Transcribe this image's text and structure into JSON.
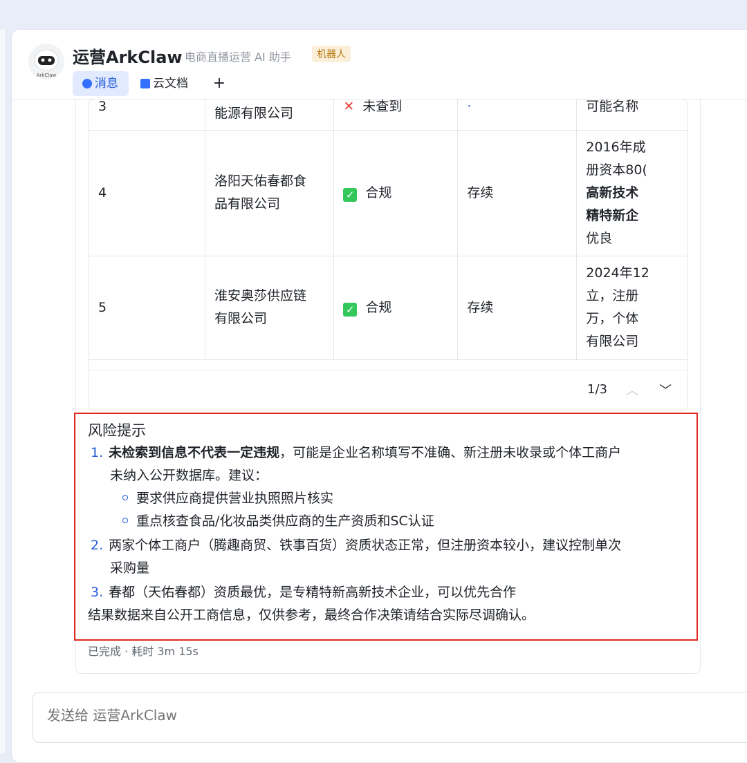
{
  "header": {
    "bot_name": "运营ArkClaw",
    "bot_subtitle": "电商直播运营 AI 助手",
    "bot_tag": "机器人",
    "avatar_label": "ArkClaw",
    "tabs": [
      {
        "label": "消息",
        "icon": "message-icon"
      },
      {
        "label": "云文档",
        "icon": "doc-icon"
      },
      {
        "label": "+",
        "icon": "plus-icon"
      }
    ]
  },
  "table": {
    "rows": [
      {
        "no": "3",
        "company_lines": [
          "",
          "能源有限公司"
        ],
        "compliance": "未查到",
        "compliance_icon": "cross-icon",
        "status": "·",
        "note_lines": [
          "可能名称"
        ]
      },
      {
        "no": "4",
        "company_lines": [
          "洛阳天佑春都食",
          "品有限公司"
        ],
        "compliance": "合规",
        "compliance_icon": "check-icon",
        "status": "存续",
        "note_lines": [
          "2016年成",
          "册资本80(",
          "高新技术",
          "精特新企",
          "优良"
        ]
      },
      {
        "no": "5",
        "company_lines": [
          "淮安奥莎供应链",
          "有限公司"
        ],
        "compliance": "合规",
        "compliance_icon": "check-icon",
        "status": "存续",
        "note_lines": [
          "2024年12",
          "立，注册",
          "万，个体",
          "有限公司"
        ]
      }
    ],
    "pager": "1/3"
  },
  "risk": {
    "title": "风险提示",
    "item1_bold": "未检索到信息不代表一定违规",
    "item1_rest": "，可能是企业名称填写不准确、新注册未收录或个体工商户",
    "item1_cont": "未纳入公开数据库。建议：",
    "sub1": "要求供应商提供营业执照照片核实",
    "sub2": "重点核查食品/化妆品类供应商的生产资质和SC认证",
    "item2": "两家个体工商户（腾趣商贸、铁事百货）资质状态正常，但注册资本较小，建议控制单次",
    "item2_cont": "采购量",
    "item3": "春都（天佑春都）资质最优，是专精特新高新技术企业，可以优先合作",
    "footer": "结果数据来自公开工商信息，仅供参考，最终合作决策请结合实际尽调确认。"
  },
  "status": "已完成 · 耗时 3m 15s",
  "input": {
    "placeholder": "发送给 运营ArkClaw"
  }
}
